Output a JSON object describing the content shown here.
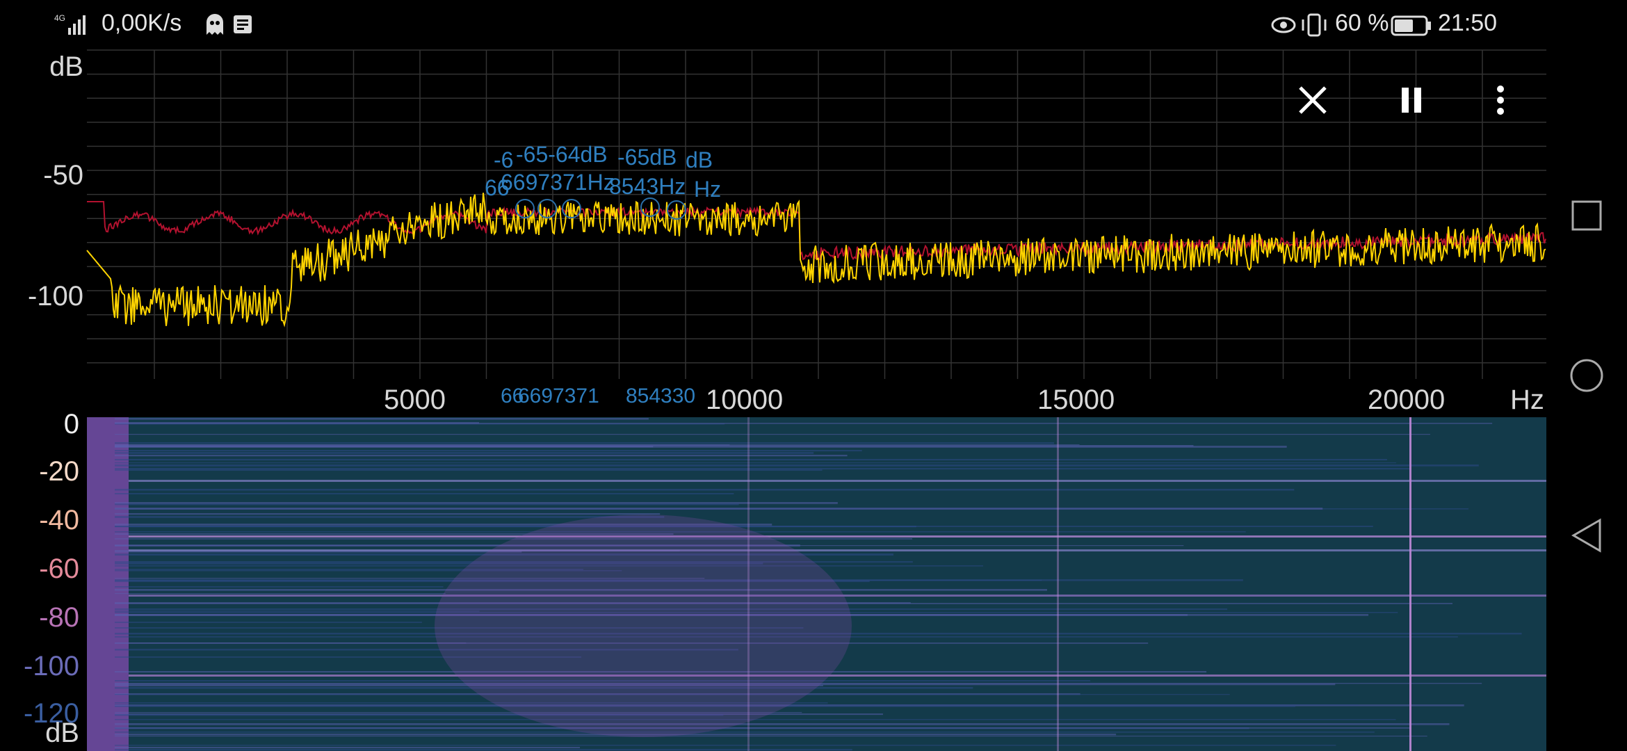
{
  "status_bar": {
    "network": "4G",
    "speed": "0,00K/s",
    "battery_percent": "60 %",
    "time": "21:50",
    "icons": [
      "signal-icon",
      "ghost-icon",
      "news-icon",
      "eye-icon",
      "vibrate-icon",
      "battery-icon"
    ]
  },
  "toolbar": {
    "close_icon": "close-icon",
    "pause_icon": "pause-icon",
    "more_icon": "more-vert-icon"
  },
  "spectrum": {
    "y_unit": "dB",
    "y_ticks": [
      "-50",
      "-100"
    ],
    "x_ticks": [
      "5000",
      "10000",
      "15000",
      "20000"
    ],
    "x_unit": "Hz",
    "peak_labels": {
      "db_left": "-65-64dB",
      "db_left_overlap": "-6",
      "db_right": "-65dB",
      "db_right_overlap": "dB",
      "hz_left": "6697371Hz",
      "hz_left_overlap": "66",
      "hz_right": "8543Hz",
      "hz_right_overlap": "Hz",
      "axis_left": "6697371",
      "axis_left_overlap": "66",
      "axis_right": "854330"
    },
    "colors": {
      "max_trace": "#b3122f",
      "current_trace": "#ffd400",
      "grid": "#3a3a3a",
      "marker": "#2b6fa8"
    }
  },
  "spectrogram": {
    "y_ticks": [
      "0",
      "-20",
      "-40",
      "-60",
      "-80",
      "-100",
      "-120"
    ],
    "y_unit": "dB",
    "tick_colors": [
      "#f0f0f0",
      "#f4d9c8",
      "#f1b9a0",
      "#e38a9a",
      "#b773b5",
      "#6b6cb8",
      "#3a5ea0"
    ]
  },
  "nav": {
    "recents_icon": "square-icon",
    "home_icon": "circle-icon",
    "back_icon": "triangle-back-icon"
  }
}
